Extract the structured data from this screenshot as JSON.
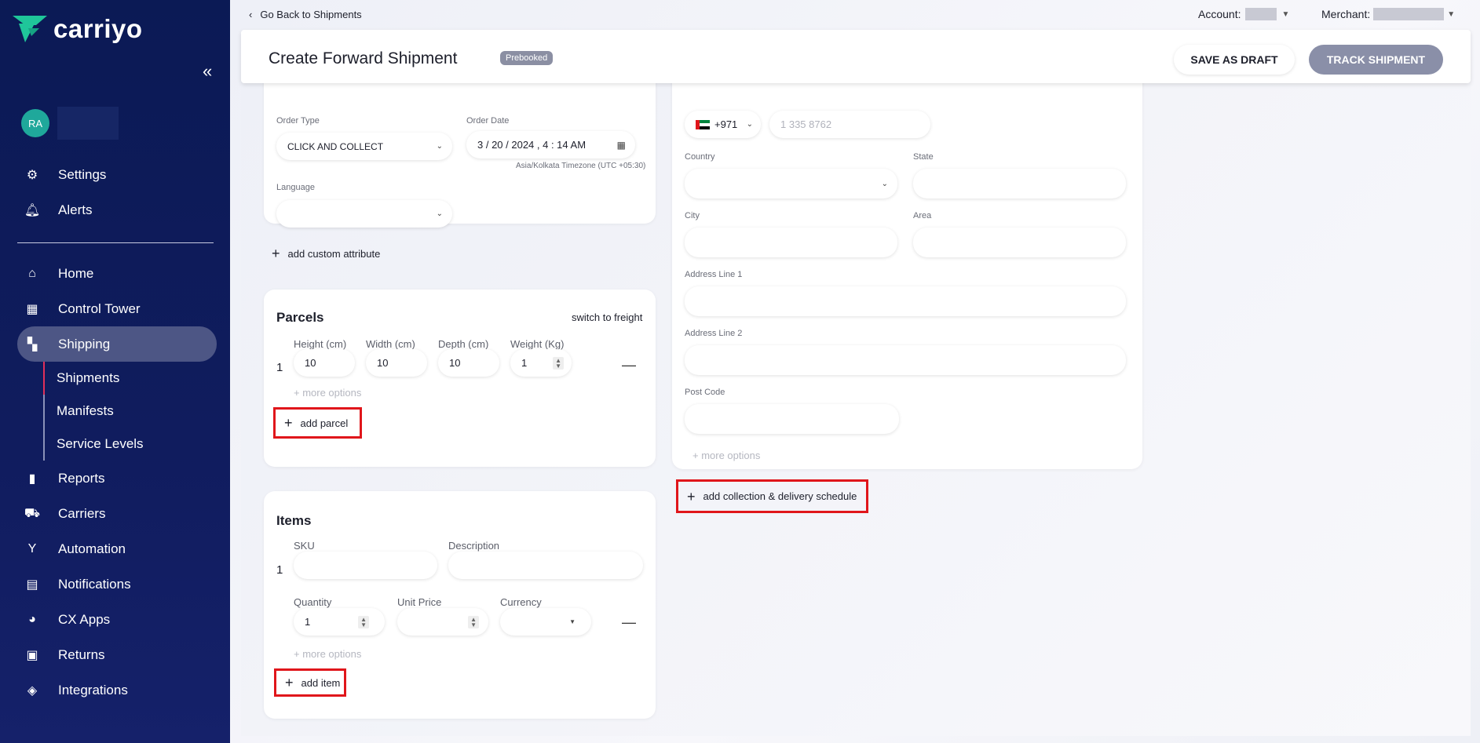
{
  "sidebar": {
    "logo_text": "carriyo",
    "collapse_icon": "double-chevron-left",
    "avatar_initials": "RA",
    "items_top": [
      {
        "label": "Settings",
        "icon": "gear-icon"
      },
      {
        "label": "Alerts",
        "icon": "bell-icon"
      }
    ],
    "items": [
      {
        "label": "Home",
        "icon": "home-icon"
      },
      {
        "label": "Control Tower",
        "icon": "dashboard-icon"
      },
      {
        "label": "Shipping",
        "icon": "shipping-icon"
      }
    ],
    "shipping_sub": [
      {
        "label": "Shipments"
      },
      {
        "label": "Manifests"
      },
      {
        "label": "Service Levels"
      }
    ],
    "items_bottom": [
      {
        "label": "Reports",
        "icon": "bar-chart-icon"
      },
      {
        "label": "Carriers",
        "icon": "truck-icon"
      },
      {
        "label": "Automation",
        "icon": "fork-icon"
      },
      {
        "label": "Notifications",
        "icon": "message-icon"
      },
      {
        "label": "CX Apps",
        "icon": "palette-icon"
      },
      {
        "label": "Returns",
        "icon": "return-box-icon"
      },
      {
        "label": "Integrations",
        "icon": "layers-icon"
      }
    ],
    "accent_color": "#4d5685"
  },
  "topbar": {
    "back_label": "Go Back to Shipments",
    "account_label": "Account:",
    "merchant_label": "Merchant:"
  },
  "header": {
    "title": "Create Forward Shipment",
    "badge": "Prebooked",
    "save_draft": "SAVE AS DRAFT",
    "track": "TRACK SHIPMENT"
  },
  "order": {
    "order_type_label": "Order Type",
    "order_type_value": "CLICK AND COLLECT",
    "order_date_label": "Order Date",
    "order_date_value": "3 / 20 / 2024 , 4 : 14  AM",
    "timezone": "Asia/Kolkata Timezone (UTC +05:30)",
    "language_label": "Language",
    "language_value": ""
  },
  "custom_attr": "add custom attribute",
  "parcels": {
    "title": "Parcels",
    "switch": "switch to freight",
    "headers": [
      "Height (cm)",
      "Width (cm)",
      "Depth (cm)",
      "Weight (Kg)"
    ],
    "row_num": "1",
    "values": [
      "10",
      "10",
      "10",
      "1"
    ],
    "more": "+  more options",
    "add": "add parcel"
  },
  "items": {
    "title": "Items",
    "sku_label": "SKU",
    "desc_label": "Description",
    "row_num": "1",
    "qty_label": "Quantity",
    "price_label": "Unit Price",
    "currency_label": "Currency",
    "qty_value": "1",
    "more": "+  more options",
    "add": "add item"
  },
  "address": {
    "phone_code": "+971",
    "phone_placeholder": "1 335 8762",
    "country_label": "Country",
    "state_label": "State",
    "city_label": "City",
    "area_label": "Area",
    "addr1_label": "Address Line 1",
    "addr2_label": "Address Line 2",
    "post_label": "Post Code",
    "more": "+  more options",
    "schedule": "add collection & delivery schedule"
  }
}
